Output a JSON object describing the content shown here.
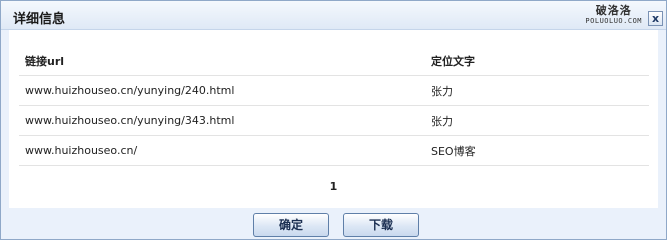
{
  "dialog": {
    "title": "详细信息",
    "close_label": "x"
  },
  "watermark": {
    "main": "破洛洛",
    "sub": "POLUOLUO.COM"
  },
  "table": {
    "headers": [
      "链接url",
      "定位文字"
    ],
    "rows": [
      [
        "www.huizhouseo.cn/yunying/240.html",
        "张力"
      ],
      [
        "www.huizhouseo.cn/yunying/343.html",
        "张力"
      ],
      [
        "www.huizhouseo.cn/",
        "SEO博客"
      ]
    ]
  },
  "pager": {
    "current": "1"
  },
  "buttons": {
    "confirm": "确定",
    "download": "下载"
  }
}
